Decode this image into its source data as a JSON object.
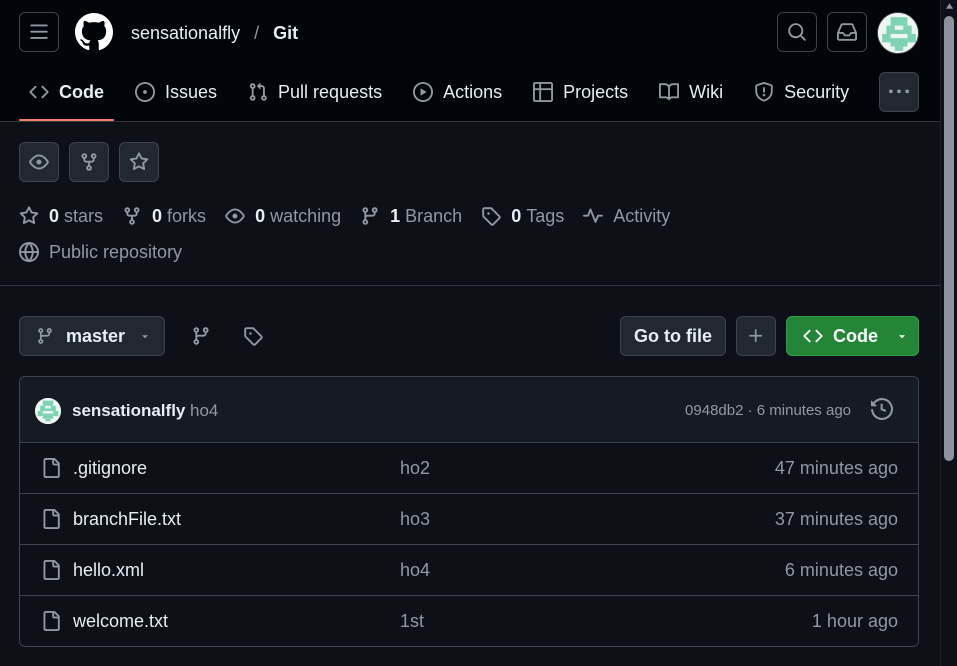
{
  "header": {
    "owner": "sensationalfly",
    "separator": "/",
    "repo": "Git"
  },
  "tabs": [
    {
      "label": "Code",
      "icon": "code-icon",
      "active": true
    },
    {
      "label": "Issues",
      "icon": "issue-icon"
    },
    {
      "label": "Pull requests",
      "icon": "pull-request-icon"
    },
    {
      "label": "Actions",
      "icon": "play-icon"
    },
    {
      "label": "Projects",
      "icon": "table-icon"
    },
    {
      "label": "Wiki",
      "icon": "book-icon"
    },
    {
      "label": "Security",
      "icon": "shield-icon"
    }
  ],
  "stats": {
    "stars_count": "0",
    "stars_label": "stars",
    "forks_count": "0",
    "forks_label": "forks",
    "watching_count": "0",
    "watching_label": "watching",
    "branch_count": "1",
    "branch_label": "Branch",
    "tags_count": "0",
    "tags_label": "Tags",
    "activity_label": "Activity"
  },
  "visibility": "Public repository",
  "toolbar": {
    "branch": "master",
    "go_to_file": "Go to file",
    "code_label": "Code"
  },
  "commit": {
    "author": "sensationalfly",
    "message": "ho4",
    "meta": "0948db2 · 6 minutes ago"
  },
  "files": [
    {
      "name": ".gitignore",
      "message": "ho2",
      "date": "47 minutes ago"
    },
    {
      "name": "branchFile.txt",
      "message": "ho3",
      "date": "37 minutes ago"
    },
    {
      "name": "hello.xml",
      "message": "ho4",
      "date": "6 minutes ago"
    },
    {
      "name": "welcome.txt",
      "message": "1st",
      "date": "1 hour ago"
    }
  ],
  "colors": {
    "background": "#0d1117",
    "header_bg": "#010409",
    "accent_underline": "#f78166",
    "primary_green": "#238636",
    "muted_text": "#9198a1"
  }
}
